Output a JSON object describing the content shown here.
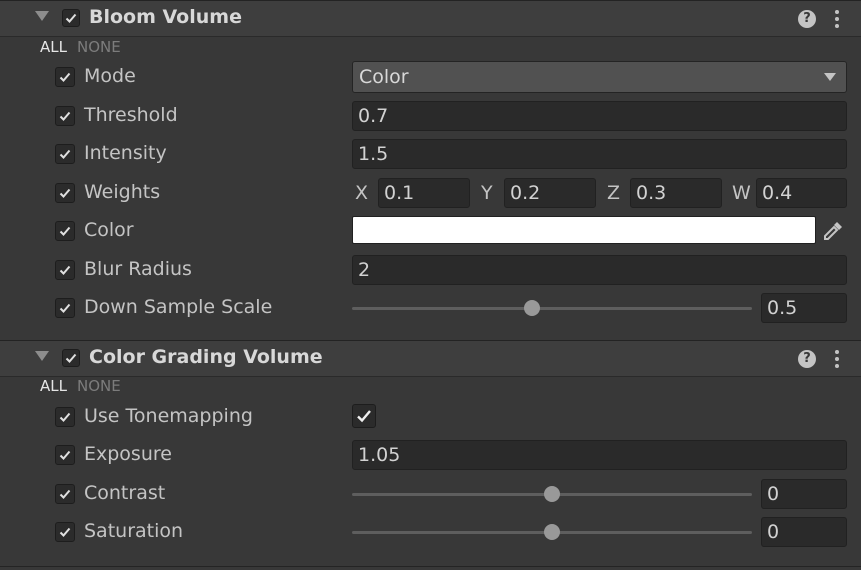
{
  "bloom": {
    "title": "Bloom Volume",
    "enabled": true,
    "all_label": "ALL",
    "none_label": "NONE",
    "mode": {
      "label": "Mode",
      "value": "Color"
    },
    "threshold": {
      "label": "Threshold",
      "value": "0.7"
    },
    "intensity": {
      "label": "Intensity",
      "value": "1.5"
    },
    "weights": {
      "label": "Weights",
      "x_label": "X",
      "x": "0.1",
      "y_label": "Y",
      "y": "0.2",
      "z_label": "Z",
      "z": "0.3",
      "w_label": "W",
      "w": "0.4"
    },
    "color": {
      "label": "Color",
      "value": "#FFFFFF"
    },
    "blur_radius": {
      "label": "Blur Radius",
      "value": "2"
    },
    "down_sample_scale": {
      "label": "Down Sample Scale",
      "value": "0.5",
      "slider_fraction": 0.45
    }
  },
  "color_grading": {
    "title": "Color Grading Volume",
    "enabled": true,
    "all_label": "ALL",
    "none_label": "NONE",
    "use_tonemapping": {
      "label": "Use Tonemapping",
      "checked": true
    },
    "exposure": {
      "label": "Exposure",
      "value": "1.05"
    },
    "contrast": {
      "label": "Contrast",
      "value": "0",
      "slider_fraction": 0.5
    },
    "saturation": {
      "label": "Saturation",
      "value": "0",
      "slider_fraction": 0.5
    }
  },
  "icons": {
    "help": "help-icon",
    "menu": "kebab-menu-icon",
    "foldout": "foldout-arrow-icon",
    "eyedropper": "eyedropper-icon"
  },
  "help_glyph": "?"
}
